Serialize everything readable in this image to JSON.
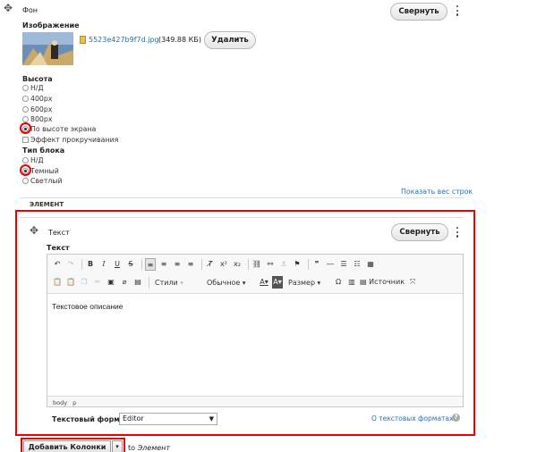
{
  "background": {
    "title": "Фон",
    "collapse_label": "Свернуть",
    "image_label": "Изображение",
    "file_name": "5523e427b9f7d.jpg",
    "file_size": "(349.88 КБ)",
    "delete_label": "Удалить",
    "height_label": "Высота",
    "height_options": [
      "Н/Д",
      "400px",
      "600px",
      "800px",
      "По высоте экрана"
    ],
    "height_selected": "По высоте экрана",
    "scroll_effect_label": "Эффект прокручивания",
    "block_type_label": "Тип блока",
    "block_type_options": [
      "Н/Д",
      "Темный",
      "Светлый"
    ],
    "block_type_selected": "Темный",
    "show_weights_label": "Показать вес строк",
    "element_label": "ЭЛЕМЕНТ"
  },
  "text_item": {
    "title": "Текст",
    "collapse_label": "Свернуть",
    "field_label": "Текст",
    "editor_content": "Текстовое описание",
    "path": [
      "body",
      "p"
    ],
    "styles_label": "Стили",
    "format_label": "Обычное",
    "size_label": "Размер",
    "source_label": "Источник",
    "text_format_label": "Текстовый формат",
    "text_format_value": "Editor",
    "about_formats_label": "О текстовых форматах"
  },
  "footer": {
    "add_columns_label": "Добавить Колонки",
    "to_label": "to",
    "target_label": "Элемент"
  },
  "colors": {
    "highlight": "#e00000",
    "link": "#2a6fb0"
  }
}
